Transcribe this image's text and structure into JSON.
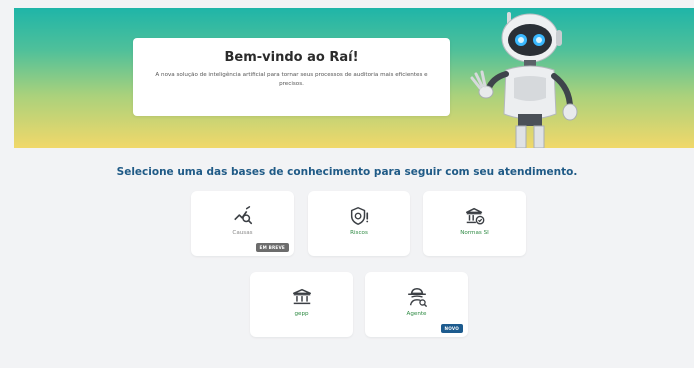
{
  "hero": {
    "title": "Bem-vindo ao Raí!",
    "subtitle": "A nova solução de inteligência artificial para tornar seus processos de auditoria mais eficientes e precisos."
  },
  "headline": "Selecione uma das bases de conhecimento para seguir com seu atendimento.",
  "cards": [
    {
      "label": "Causas",
      "icon": "chart-search-icon",
      "badge": "EM BREVE",
      "enabled": false
    },
    {
      "label": "Riscos",
      "icon": "shield-alert-icon",
      "badge": "",
      "enabled": true
    },
    {
      "label": "Normas SI",
      "icon": "bank-check-icon",
      "badge": "",
      "enabled": true
    },
    {
      "label": "gepp",
      "icon": "bank-icon",
      "badge": "",
      "enabled": true
    },
    {
      "label": "Agente",
      "icon": "detective-icon",
      "badge": "NOVO",
      "enabled": true
    }
  ],
  "colors": {
    "gradient_top": "#1fb5a8",
    "gradient_bottom": "#f1d86a",
    "headline": "#1f5a86",
    "label_green": "#2e8a43",
    "badge_grey": "#6c6c6c",
    "badge_blue": "#1d5b8e"
  }
}
